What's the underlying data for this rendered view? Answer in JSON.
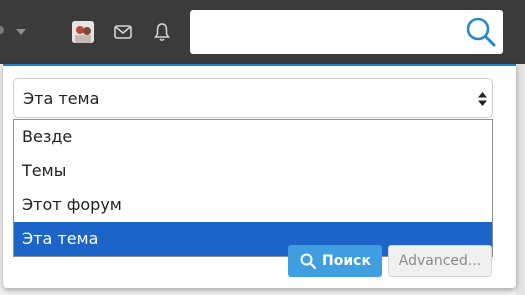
{
  "navbar": {
    "avatar_icon": "user-avatar",
    "mail_icon": "envelope-icon",
    "bell_icon": "bell-icon",
    "search": {
      "value": "",
      "placeholder": "",
      "icon": "search-icon"
    }
  },
  "search_panel": {
    "scope_select": {
      "selected": "Эта тема",
      "options": [
        "Везде",
        "Темы",
        "Этот форум",
        "Эта тема"
      ],
      "highlighted_index": 3
    },
    "search_button": "Поиск",
    "advanced_button": "Advanced..."
  },
  "colors": {
    "navbar_bg": "#3b3b3b",
    "accent_border": "#1f82c4",
    "option_highlight": "#1c64c8",
    "search_button_bg": "#3f9ee0",
    "search_icon": "#2a87c9"
  }
}
